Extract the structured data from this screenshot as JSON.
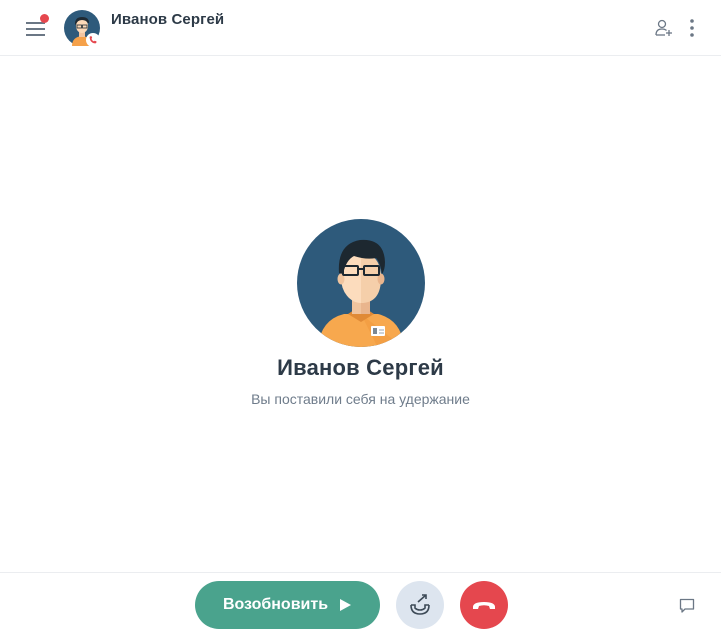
{
  "header": {
    "title": "Иванов Сергей",
    "menu_icon": "hamburger-menu-icon",
    "notification_dot_color": "#e5474e",
    "avatar_status_icon": "phone-icon",
    "add_user_icon": "add-user-icon",
    "more_icon": "more-vertical-icon"
  },
  "contact": {
    "name": "Иванов Сергей",
    "status": "Вы поставили себя на удержание"
  },
  "controls": {
    "resume_label": "Возобновить",
    "resume_icon": "play-icon",
    "transfer_icon": "call-transfer-icon",
    "hangup_icon": "hang-up-icon",
    "chat_icon": "chat-icon"
  },
  "colors": {
    "accent_green": "#4aa38d",
    "hangup_red": "#e5474e",
    "avatar_bg": "#2e5a7b",
    "text_dark": "#2d3a47",
    "text_muted": "#6f7c8b"
  }
}
